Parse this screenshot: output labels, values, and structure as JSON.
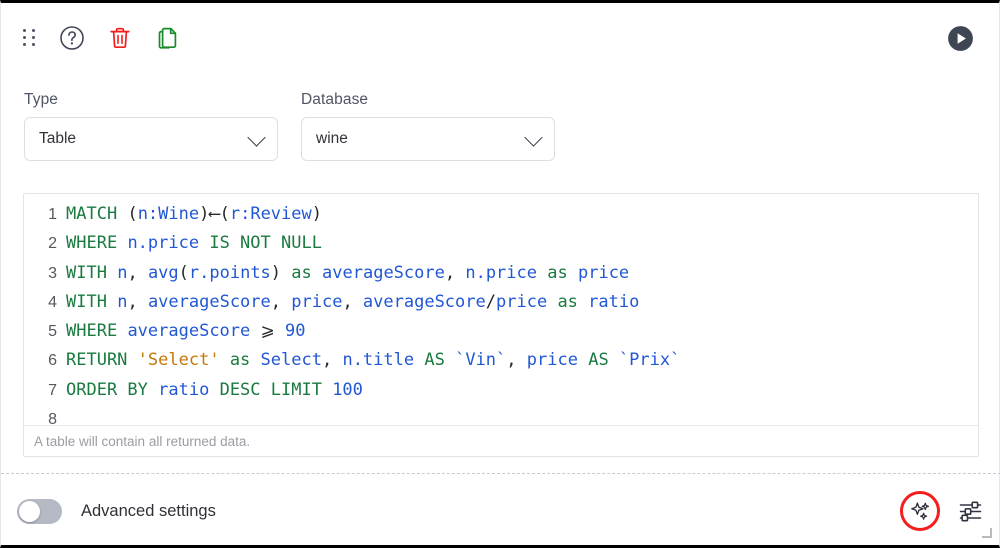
{
  "toolbar": {
    "drag_handle": "drag-handle",
    "help_label": "Help",
    "delete_label": "Delete",
    "duplicate_label": "Duplicate",
    "run_label": "Run"
  },
  "selectors": {
    "type": {
      "label": "Type",
      "value": "Table"
    },
    "database": {
      "label": "Database",
      "value": "wine"
    }
  },
  "editor": {
    "status": "A table will contain all returned data.",
    "lines": [
      {
        "n": "1",
        "tokens": [
          {
            "t": "MATCH",
            "c": "kw"
          },
          {
            "t": " ",
            "c": "pun"
          },
          {
            "t": "(",
            "c": "pun"
          },
          {
            "t": "n:Wine",
            "c": "var"
          },
          {
            "t": ")",
            "c": "pun"
          },
          {
            "t": "⟵",
            "c": "pun"
          },
          {
            "t": "(",
            "c": "pun"
          },
          {
            "t": "r:Review",
            "c": "var"
          },
          {
            "t": ")",
            "c": "pun"
          }
        ]
      },
      {
        "n": "2",
        "tokens": [
          {
            "t": "WHERE",
            "c": "kw"
          },
          {
            "t": " ",
            "c": "pun"
          },
          {
            "t": "n.price",
            "c": "var"
          },
          {
            "t": " ",
            "c": "pun"
          },
          {
            "t": "IS NOT NULL",
            "c": "kw"
          }
        ]
      },
      {
        "n": "3",
        "tokens": [
          {
            "t": "WITH",
            "c": "kw"
          },
          {
            "t": " ",
            "c": "pun"
          },
          {
            "t": "n",
            "c": "var"
          },
          {
            "t": ", ",
            "c": "pun"
          },
          {
            "t": "avg",
            "c": "var"
          },
          {
            "t": "(",
            "c": "pun"
          },
          {
            "t": "r.points",
            "c": "var"
          },
          {
            "t": ")",
            "c": "pun"
          },
          {
            "t": " ",
            "c": "pun"
          },
          {
            "t": "as",
            "c": "kw"
          },
          {
            "t": " ",
            "c": "pun"
          },
          {
            "t": "averageScore",
            "c": "var"
          },
          {
            "t": ", ",
            "c": "pun"
          },
          {
            "t": "n.price",
            "c": "var"
          },
          {
            "t": " ",
            "c": "pun"
          },
          {
            "t": "as",
            "c": "kw"
          },
          {
            "t": " ",
            "c": "pun"
          },
          {
            "t": "price",
            "c": "var"
          }
        ]
      },
      {
        "n": "4",
        "tokens": [
          {
            "t": "WITH",
            "c": "kw"
          },
          {
            "t": " ",
            "c": "pun"
          },
          {
            "t": "n",
            "c": "var"
          },
          {
            "t": ", ",
            "c": "pun"
          },
          {
            "t": "averageScore",
            "c": "var"
          },
          {
            "t": ", ",
            "c": "pun"
          },
          {
            "t": "price",
            "c": "var"
          },
          {
            "t": ", ",
            "c": "pun"
          },
          {
            "t": "averageScore",
            "c": "var"
          },
          {
            "t": "/",
            "c": "pun"
          },
          {
            "t": "price",
            "c": "var"
          },
          {
            "t": " ",
            "c": "pun"
          },
          {
            "t": "as",
            "c": "kw"
          },
          {
            "t": " ",
            "c": "pun"
          },
          {
            "t": "ratio",
            "c": "var"
          }
        ]
      },
      {
        "n": "5",
        "tokens": [
          {
            "t": "WHERE",
            "c": "kw"
          },
          {
            "t": " ",
            "c": "pun"
          },
          {
            "t": "averageScore",
            "c": "var"
          },
          {
            "t": " ",
            "c": "pun"
          },
          {
            "t": "⩾",
            "c": "pun"
          },
          {
            "t": " ",
            "c": "pun"
          },
          {
            "t": "90",
            "c": "num"
          }
        ]
      },
      {
        "n": "6",
        "tokens": [
          {
            "t": "RETURN",
            "c": "kw"
          },
          {
            "t": " ",
            "c": "pun"
          },
          {
            "t": "'Select'",
            "c": "str"
          },
          {
            "t": " ",
            "c": "pun"
          },
          {
            "t": "as",
            "c": "kw"
          },
          {
            "t": " ",
            "c": "pun"
          },
          {
            "t": "Select",
            "c": "var"
          },
          {
            "t": ", ",
            "c": "pun"
          },
          {
            "t": "n.title",
            "c": "var"
          },
          {
            "t": " ",
            "c": "pun"
          },
          {
            "t": "AS",
            "c": "kw"
          },
          {
            "t": " ",
            "c": "pun"
          },
          {
            "t": "`Vin`",
            "c": "var"
          },
          {
            "t": ", ",
            "c": "pun"
          },
          {
            "t": "price",
            "c": "var"
          },
          {
            "t": " ",
            "c": "pun"
          },
          {
            "t": "AS",
            "c": "kw"
          },
          {
            "t": " ",
            "c": "pun"
          },
          {
            "t": "`Prix`",
            "c": "var"
          }
        ]
      },
      {
        "n": "7",
        "tokens": [
          {
            "t": "ORDER BY",
            "c": "kw"
          },
          {
            "t": " ",
            "c": "pun"
          },
          {
            "t": "ratio",
            "c": "var"
          },
          {
            "t": " ",
            "c": "pun"
          },
          {
            "t": "DESC LIMIT",
            "c": "kw"
          },
          {
            "t": " ",
            "c": "pun"
          },
          {
            "t": "100",
            "c": "num"
          }
        ]
      },
      {
        "n": "8",
        "tokens": []
      }
    ]
  },
  "footer": {
    "advanced_label": "Advanced settings",
    "advanced_enabled": false,
    "ai_label": "AI assist",
    "settings_label": "Settings"
  },
  "colors": {
    "keyword": "#1a7a3f",
    "variable": "#2157d4",
    "string": "#c4780a",
    "delete_icon": "#f41d1d",
    "duplicate_icon": "#1a8a2a",
    "highlight_ring": "#f41d1d",
    "run_button": "#3f4653"
  }
}
